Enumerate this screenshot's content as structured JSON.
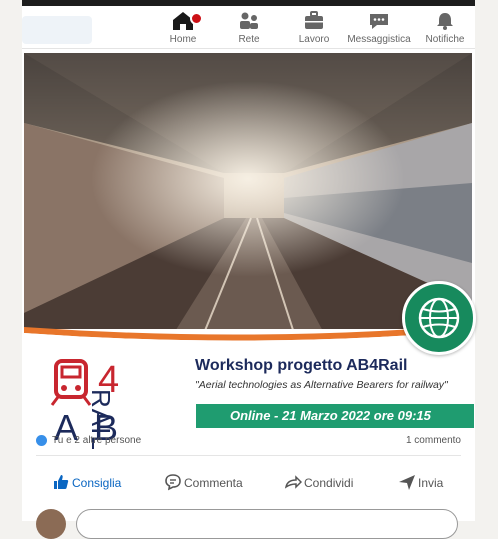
{
  "nav": {
    "items": [
      {
        "label": "Home"
      },
      {
        "label": "Rete"
      },
      {
        "label": "Lavoro"
      },
      {
        "label": "Messaggistica"
      },
      {
        "label": "Notifiche"
      }
    ]
  },
  "post": {
    "image": {
      "logo_text_left": "4",
      "logo_text_a": "A",
      "logo_text_b": "B",
      "logo_text_rail": "RAIL",
      "title": "Workshop progetto AB4Rail",
      "subtitle": "\"Aerial technologies as Alternative Bearers for railway\"",
      "date_line": "Online - 21 Marzo 2022 ore 09:15"
    },
    "reactions_text": "Tu e 2 altre persone",
    "comments_text": "1 commento",
    "actions": {
      "like": "Consiglia",
      "comment": "Commenta",
      "share": "Condividi",
      "send": "Invia"
    }
  },
  "colors": {
    "brand_blue": "#0a66c2",
    "green": "#1f9c70",
    "navy": "#1c2a5b",
    "red": "#cc1016"
  }
}
